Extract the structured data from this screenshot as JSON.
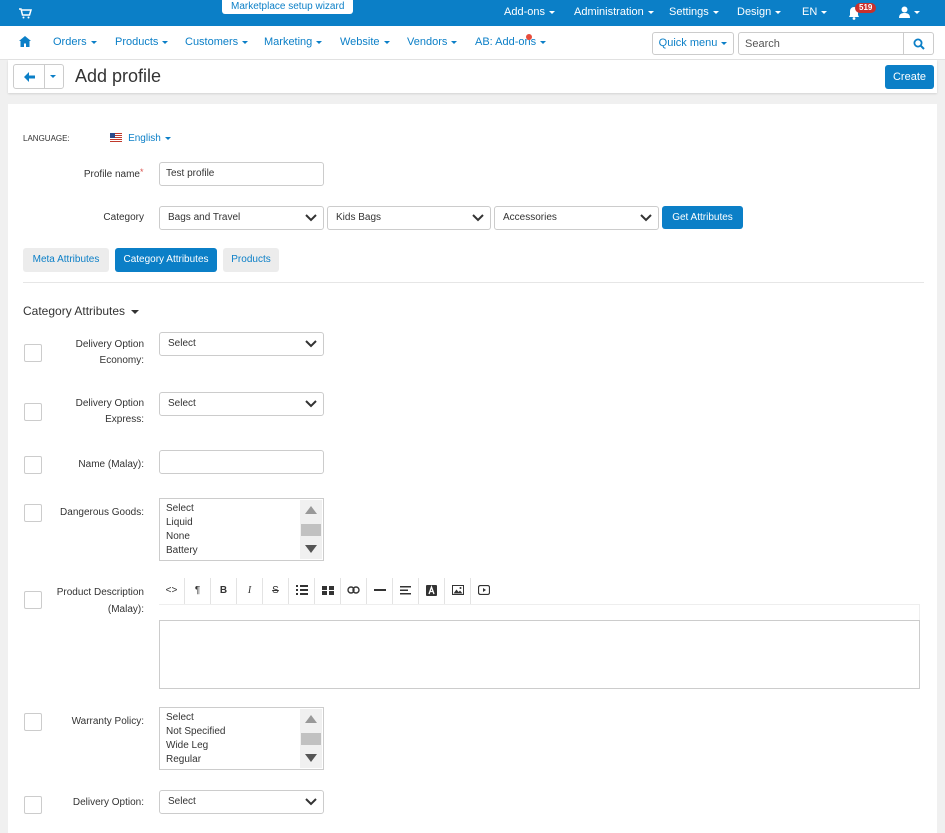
{
  "topbar": {
    "wizard": "Marketplace setup wizard",
    "nav": [
      "Add-ons",
      "Administration",
      "Settings",
      "Design",
      "EN"
    ],
    "badge": "519"
  },
  "secnav": {
    "items": [
      "Orders",
      "Products",
      "Customers",
      "Marketing",
      "Website",
      "Vendors",
      "AB: Add-ons"
    ],
    "quick_menu": "Quick menu",
    "search_placeholder": "Search"
  },
  "page": {
    "title": "Add profile",
    "create_label": "Create"
  },
  "form": {
    "language_label": "LANGUAGE:",
    "language_value": "English",
    "profile_name_label": "Profile name",
    "required_mark": "*",
    "profile_name_value": "Test profile",
    "category_label": "Category",
    "category_1": "Bags and Travel",
    "category_2": "Kids Bags",
    "category_3": "Accessories",
    "get_attributes": "Get Attributes"
  },
  "tabs": [
    "Meta Attributes",
    "Category Attributes",
    "Products"
  ],
  "section_title": "Category Attributes",
  "attributes": {
    "delivery_economy_label_1": "Delivery Option",
    "delivery_economy_label_2": "Economy:",
    "delivery_economy_value": "Select",
    "delivery_express_label_1": "Delivery Option",
    "delivery_express_label_2": "Express:",
    "delivery_express_value": "Select",
    "name_malay_label": "Name (Malay):",
    "dangerous_goods_label": "Dangerous Goods:",
    "dangerous_goods_options": [
      "Select",
      "Liquid",
      "None",
      "Battery"
    ],
    "desc_label_1": "Product Description",
    "desc_label_2": "(Malay):",
    "warranty_label": "Warranty Policy:",
    "warranty_options": [
      "Select",
      "Not Specified",
      "Wide Leg",
      "Regular"
    ],
    "delivery_option_label": "Delivery Option:",
    "delivery_option_value": "Select"
  },
  "editor_tools": [
    "<>",
    "¶",
    "B",
    "I",
    "S"
  ]
}
